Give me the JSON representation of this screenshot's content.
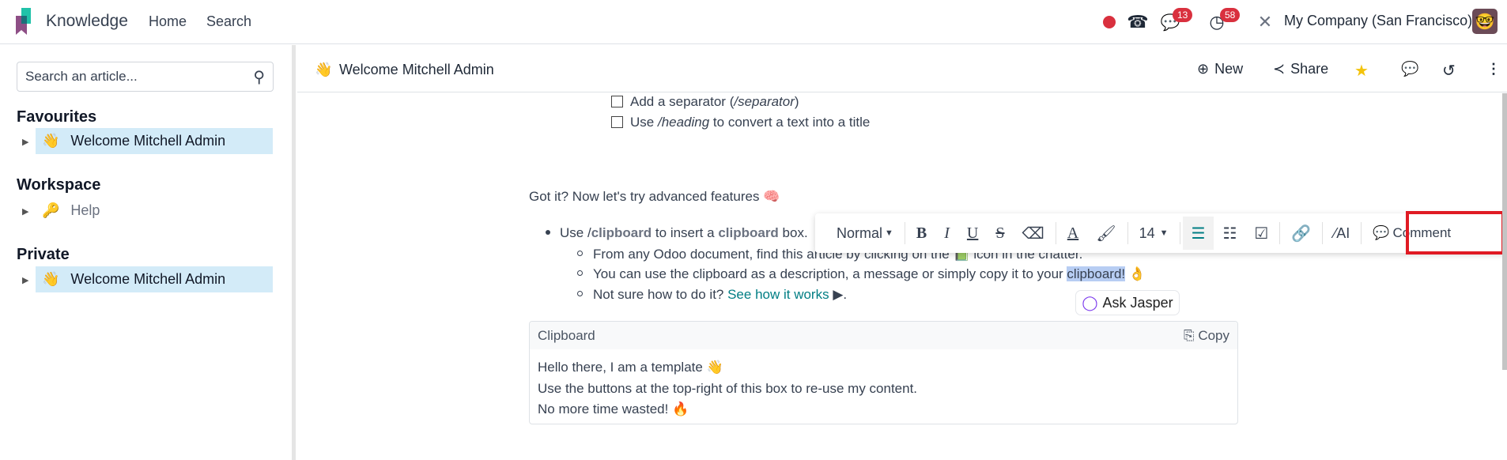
{
  "topbar": {
    "app_name": "Knowledge",
    "nav": [
      "Home",
      "Search"
    ],
    "messages_count": "13",
    "activities_count": "58",
    "company": "My Company (San Francisco)",
    "colors": {
      "badge": "#d9303e",
      "status_dot": "#d9303e"
    }
  },
  "sidebar": {
    "search_placeholder": "Search an article...",
    "sections": [
      {
        "title": "Favourites",
        "items": [
          {
            "icon": "👋",
            "label": "Welcome Mitchell Admin",
            "selected": true
          }
        ]
      },
      {
        "title": "Workspace",
        "items": [
          {
            "icon": "🔑",
            "label": "Help",
            "selected": false
          }
        ]
      },
      {
        "title": "Private",
        "items": [
          {
            "icon": "👋",
            "label": "Welcome Mitchell Admin",
            "selected": true
          }
        ]
      }
    ]
  },
  "article": {
    "icon": "👋",
    "title": "Welcome Mitchell Admin",
    "actions": {
      "new": "New",
      "share": "Share"
    },
    "checklist": [
      {
        "pre": "Add a separator (",
        "em": "/separator",
        "post": ")"
      },
      {
        "pre": "Use ",
        "em": "/heading",
        "post": " to convert a text into a title"
      }
    ],
    "advanced": "Got it? Now let's try advanced features 🧠",
    "bullet": {
      "p1": "Use /",
      "k1": "clipboard",
      "p2": " to insert a ",
      "k2": "clipboard",
      "p3": " box."
    },
    "sub": [
      "From any Odoo document, find this article by clicking on the 📗 icon in the chatter.",
      {
        "pre": "You can use the clipboard as a description, a message or simply copy it to your ",
        "sel": "clipboard!",
        "post": " 👌"
      },
      {
        "pre": "Not sure how to do it? ",
        "link": "See how it works",
        "post": " ▶."
      }
    ],
    "clipboard": {
      "title": "Clipboard",
      "copy": "Copy",
      "lines": [
        "Hello there, I am a template 👋",
        "Use the buttons at the top-right of this box to re-use my content.",
        "No more time wasted! 🔥"
      ]
    }
  },
  "toolbar": {
    "style": "Normal",
    "font_size": "14",
    "ai": "AI",
    "comment": "Comment",
    "highlight_color": "#e01b24"
  },
  "jasper": {
    "label": "Ask Jasper"
  }
}
